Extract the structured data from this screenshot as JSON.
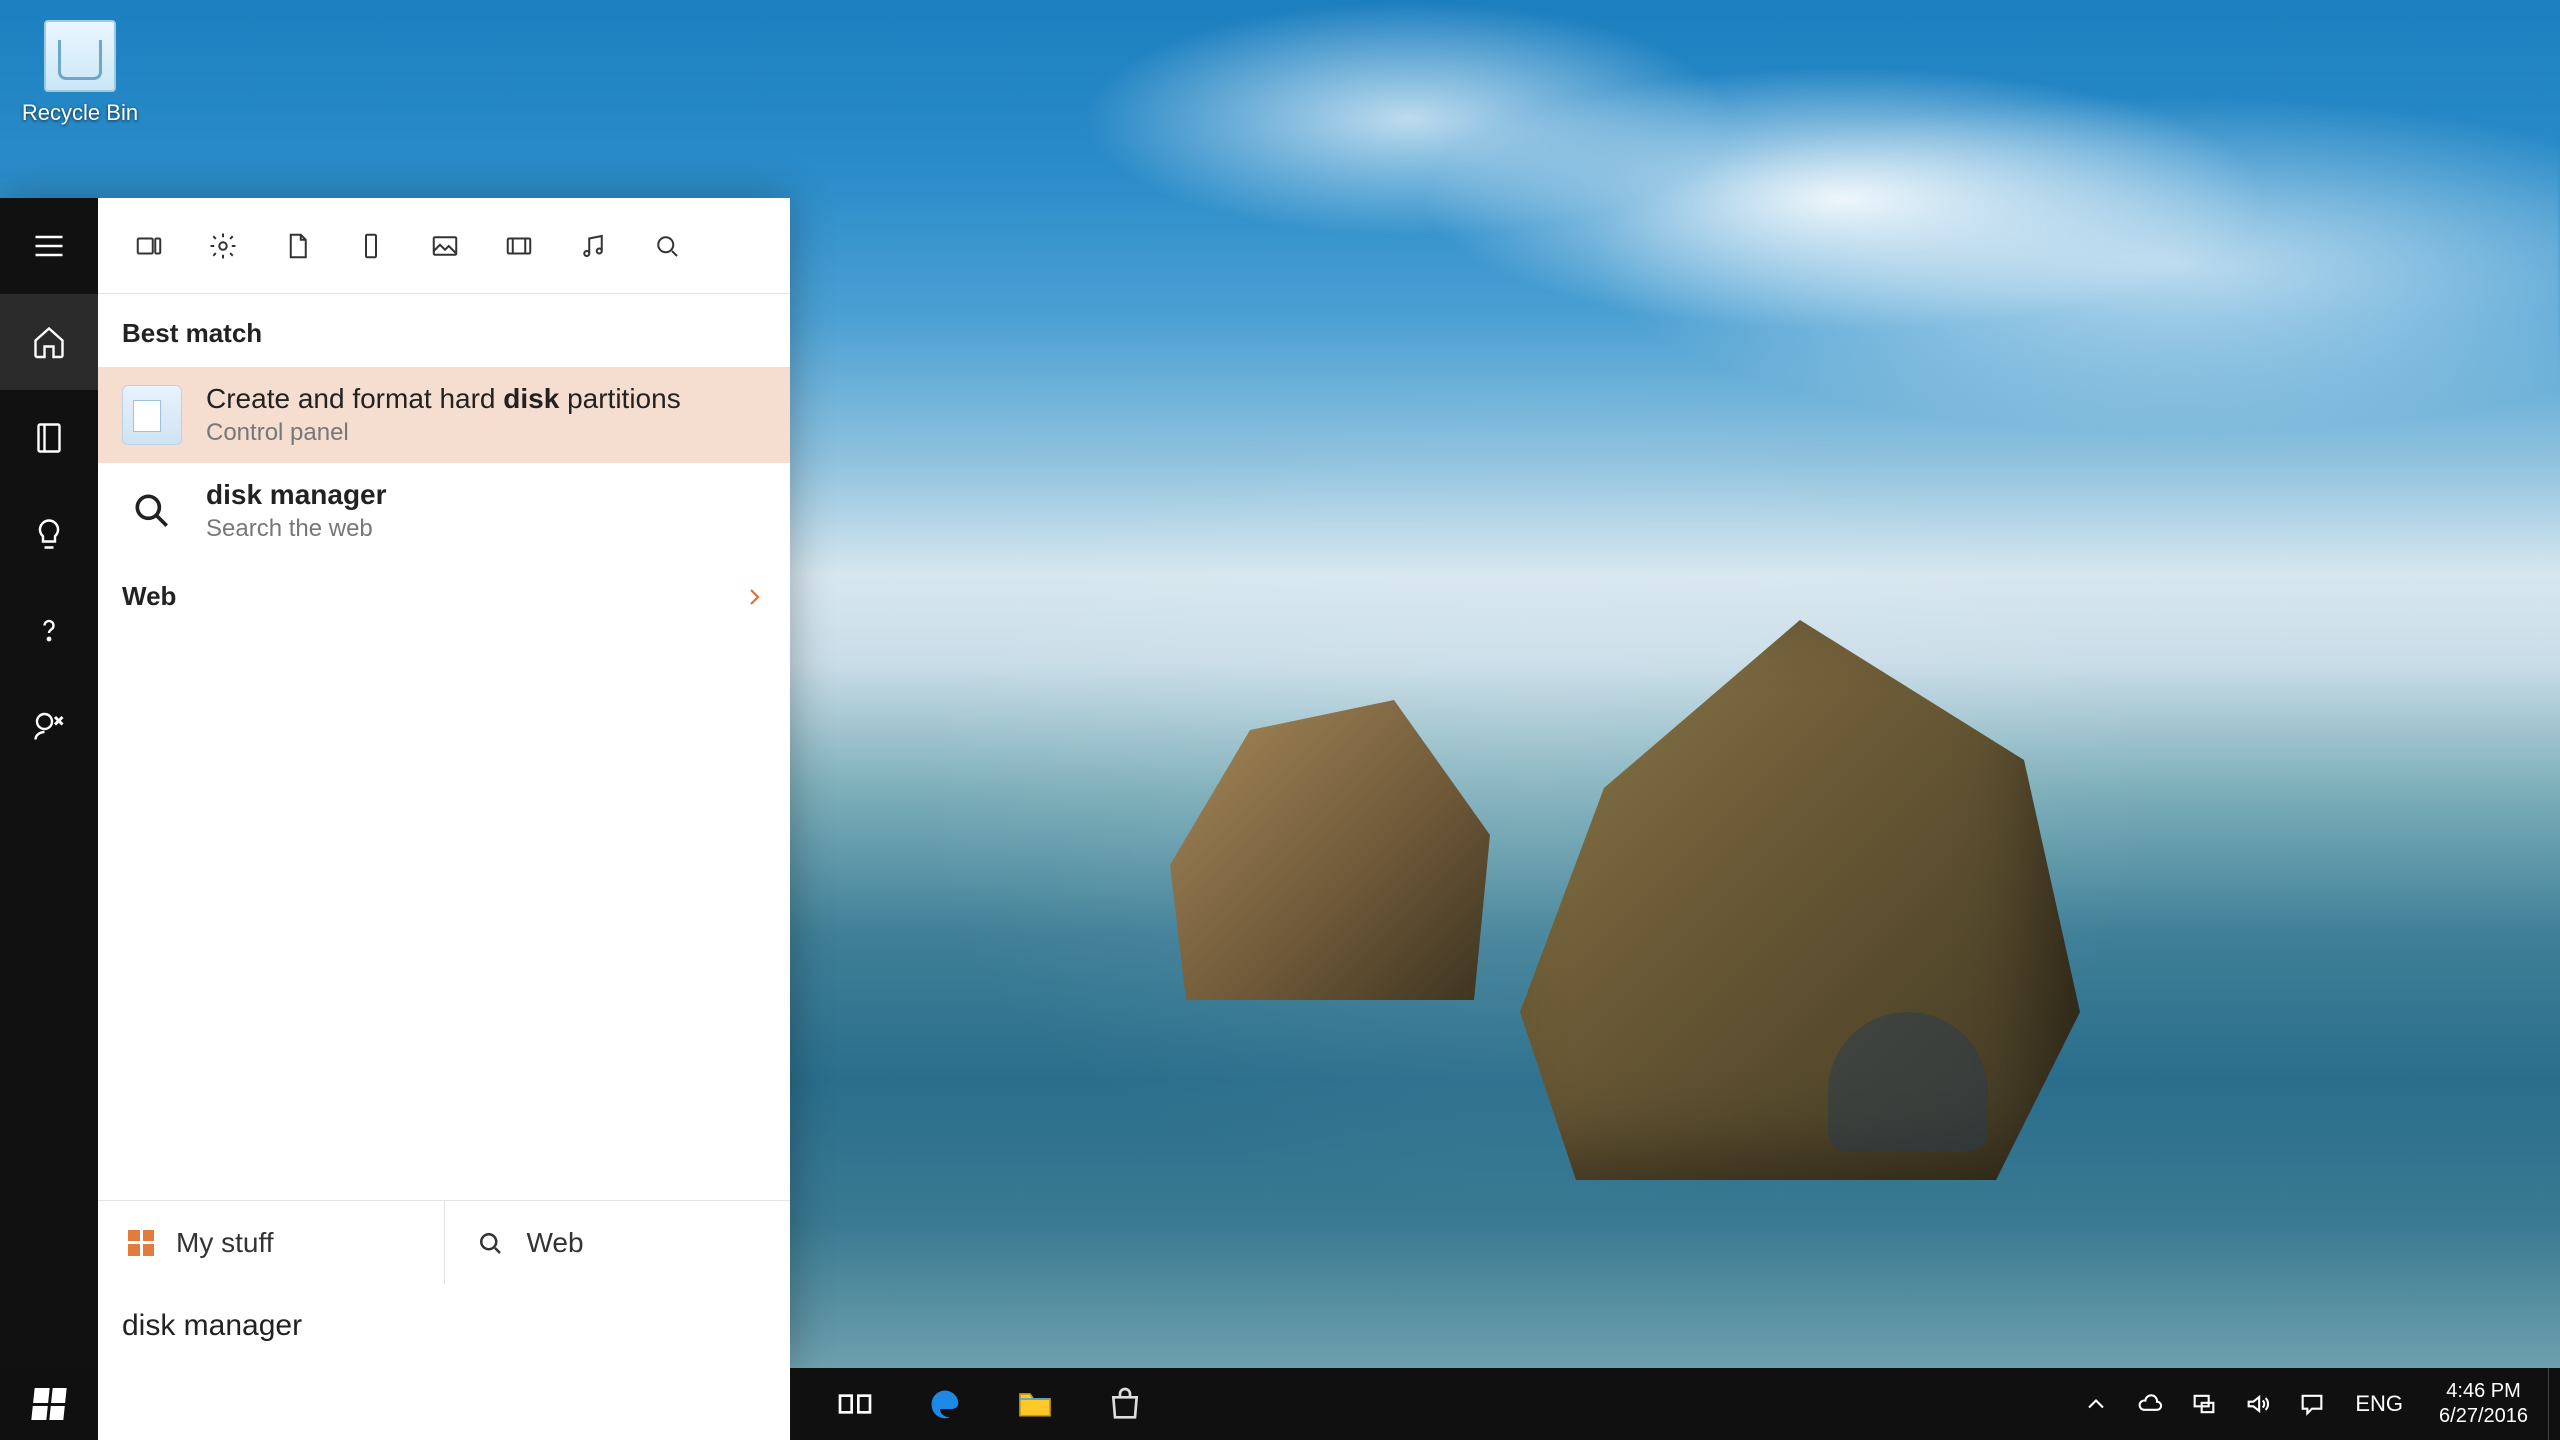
{
  "desktop": {
    "recycle_bin_label": "Recycle Bin"
  },
  "cortana": {
    "filters": [
      "apps",
      "settings",
      "documents",
      "phone",
      "photos",
      "video",
      "music",
      "web"
    ],
    "section_best_match": "Best match",
    "best_match": {
      "title_pre": "Create and format hard ",
      "title_bold": "disk",
      "title_post": " partitions",
      "subtitle": "Control panel"
    },
    "web_suggestion": {
      "title": "disk manager",
      "subtitle": "Search the web"
    },
    "web_header": "Web",
    "scope_mystuff": "My stuff",
    "scope_web": "Web",
    "search_value": "disk manager"
  },
  "taskbar": {
    "lang": "ENG",
    "time": "4:46 PM",
    "date": "6/27/2016"
  }
}
